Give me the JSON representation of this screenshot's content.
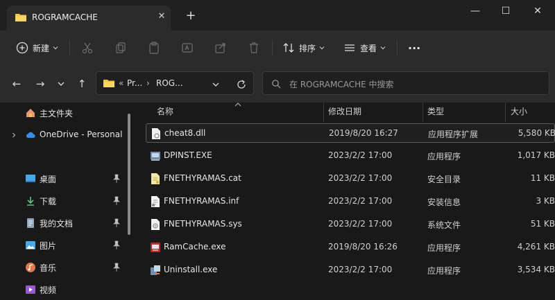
{
  "window": {
    "tab_title": "ROGRAMCACHE",
    "tab_close": "✕",
    "new_tab": "+",
    "minimize": "—",
    "maximize": "☐",
    "close": "✕"
  },
  "toolbar": {
    "new_label": "新建",
    "sort_label": "排序",
    "view_label": "查看",
    "more_label": "···"
  },
  "address": {
    "seg1": "«",
    "seg2": "Pr...",
    "sep": "›",
    "seg3": "ROG...",
    "search_placeholder": "在 ROGRAMCACHE 中搜索"
  },
  "sidebar": {
    "items": [
      {
        "label": "主文件夹",
        "icon": "home-icon"
      },
      {
        "label": "OneDrive - Personal",
        "icon": "cloud-icon"
      },
      {
        "label": "桌面",
        "icon": "desktop-icon"
      },
      {
        "label": "下载",
        "icon": "download-icon"
      },
      {
        "label": "我的文档",
        "icon": "document-icon"
      },
      {
        "label": "图片",
        "icon": "pictures-icon"
      },
      {
        "label": "音乐",
        "icon": "music-icon"
      },
      {
        "label": "视频",
        "icon": "video-icon"
      }
    ]
  },
  "columns": {
    "name": "名称",
    "date": "修改日期",
    "type": "类型",
    "size": "大小"
  },
  "files": [
    {
      "name": "cheat8.dll",
      "date": "2019/8/20 16:27",
      "type": "应用程序扩展",
      "size": "5,580 KB",
      "icon": "dll-icon"
    },
    {
      "name": "DPINST.EXE",
      "date": "2023/2/2 17:00",
      "type": "应用程序",
      "size": "1,017 KB",
      "icon": "exe-icon"
    },
    {
      "name": "FNETHYRAMAS.cat",
      "date": "2023/2/2 17:00",
      "type": "安全目录",
      "size": "11 KB",
      "icon": "cat-icon"
    },
    {
      "name": "FNETHYRAMAS.inf",
      "date": "2023/2/2 17:00",
      "type": "安装信息",
      "size": "3 KB",
      "icon": "inf-icon"
    },
    {
      "name": "FNETHYRAMAS.sys",
      "date": "2023/2/2 17:00",
      "type": "系统文件",
      "size": "51 KB",
      "icon": "sys-icon"
    },
    {
      "name": "RamCache.exe",
      "date": "2019/8/20 16:26",
      "type": "应用程序",
      "size": "4,261 KB",
      "icon": "ramcache-icon"
    },
    {
      "name": "Uninstall.exe",
      "date": "2023/2/2 17:00",
      "type": "应用程序",
      "size": "3,534 KB",
      "icon": "uninstall-icon"
    }
  ],
  "colors": {
    "background": "#191919",
    "toolbar": "#2b2b2b",
    "folder": "#f4c542",
    "accent": "#4aa8e8"
  }
}
